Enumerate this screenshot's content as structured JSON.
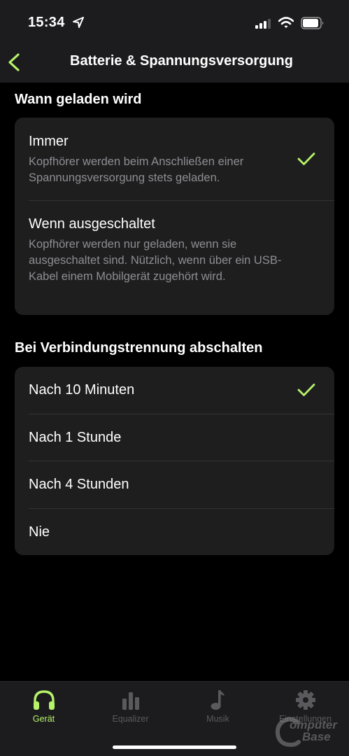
{
  "status_bar": {
    "time": "15:34"
  },
  "nav": {
    "title": "Batterie & Spannungsversorgung"
  },
  "charging": {
    "header": "Wann geladen wird",
    "options": [
      {
        "label": "Immer",
        "description": "Kopfhörer werden beim Anschließen einer Spannungsversorgung stets geladen.",
        "selected": true
      },
      {
        "label": "Wenn ausgeschaltet",
        "description": "Kopfhörer werden nur geladen, wenn sie ausgeschaltet sind. Nützlich, wenn über ein USB-Kabel einem Mobilgerät zugehört wird.",
        "selected": false
      }
    ]
  },
  "auto_off": {
    "header": "Bei Verbindungstrennung abschalten",
    "options": [
      {
        "label": "Nach 10 Minuten",
        "selected": true
      },
      {
        "label": "Nach 1 Stunde",
        "selected": false
      },
      {
        "label": "Nach 4 Stunden",
        "selected": false
      },
      {
        "label": "Nie",
        "selected": false
      }
    ]
  },
  "tabs": [
    {
      "label": "Gerät",
      "icon": "headphones-icon",
      "active": true
    },
    {
      "label": "Equalizer",
      "icon": "equalizer-icon",
      "active": false
    },
    {
      "label": "Musik",
      "icon": "music-note-icon",
      "active": false
    },
    {
      "label": "Einstellungen",
      "icon": "gear-icon",
      "active": false
    }
  ],
  "watermark": {
    "text": "ComputerBase"
  },
  "colors": {
    "accent": "#b6f36a",
    "background": "#000000",
    "card": "#1e1e1f",
    "secondary_text": "#8e8e93"
  }
}
